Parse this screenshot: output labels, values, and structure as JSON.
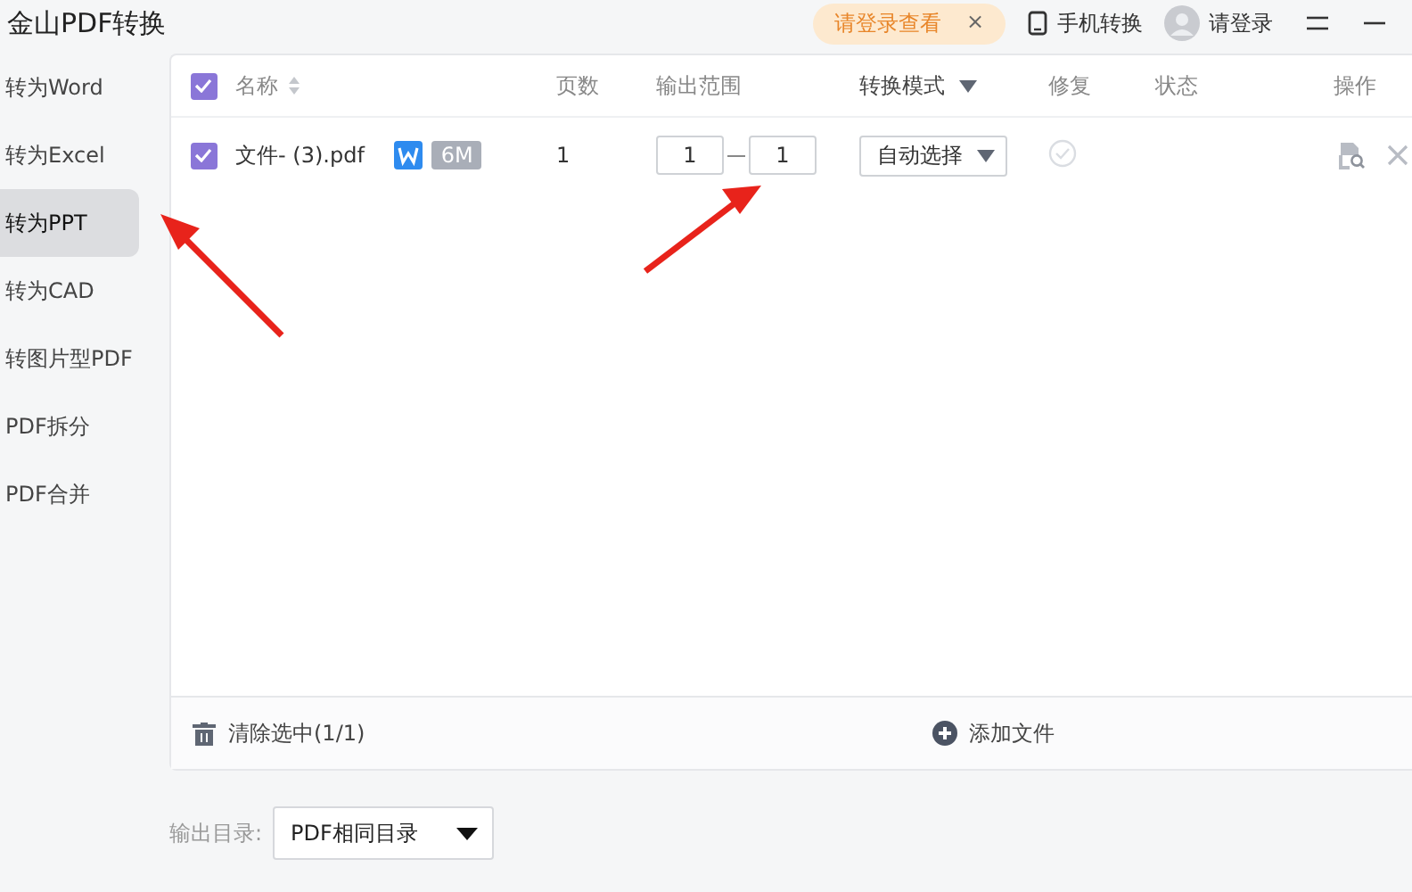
{
  "app": {
    "title": "金山PDF转换",
    "promo": "请登录查看",
    "promo_close": "×",
    "mobile": "手机转换",
    "login": "请登录"
  },
  "sidebar": {
    "items": [
      {
        "label": "转为Word",
        "selected": false
      },
      {
        "label": "转为Excel",
        "selected": false
      },
      {
        "label": "转为PPT",
        "selected": true
      },
      {
        "label": "转为CAD",
        "selected": false
      },
      {
        "label": "转图片型PDF",
        "selected": false
      },
      {
        "label": "PDF拆分",
        "selected": false
      },
      {
        "label": "PDF合并",
        "selected": false
      }
    ]
  },
  "table": {
    "all_checked": true,
    "columns": [
      "名称",
      "页数",
      "输出范围",
      "转换模式",
      "修复",
      "状态",
      "操作"
    ],
    "rows": [
      {
        "checked": true,
        "name": "文件- (3).pdf",
        "badge": "6M",
        "pages": "1",
        "range_from": "1",
        "range_to": "1",
        "mode": "自动选择",
        "repaired": false
      }
    ]
  },
  "footer": {
    "clear": "清除选中(1/1)",
    "add": "添加文件"
  },
  "output": {
    "label": "输出目录:",
    "value": "PDF相同目录"
  }
}
